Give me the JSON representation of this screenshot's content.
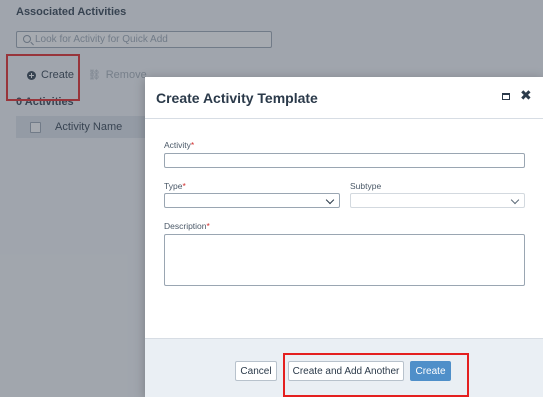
{
  "background": {
    "section_title": "Associated Activities",
    "quick_add_placeholder": "Look for Activity for Quick Add",
    "toolbar": {
      "create_label": "Create",
      "remove_label": "Remove"
    },
    "count_label": "0 Activities",
    "table": {
      "columns": [
        "Activity Name"
      ]
    }
  },
  "modal": {
    "title": "Create Activity Template",
    "fields": {
      "activity": {
        "label": "Activity",
        "required_mark": "*",
        "value": ""
      },
      "type": {
        "label": "Type",
        "required_mark": "*",
        "value": ""
      },
      "subtype": {
        "label": "Subtype",
        "value": ""
      },
      "description": {
        "label": "Description",
        "required_mark": "*",
        "value": ""
      }
    },
    "footer": {
      "cancel_label": "Cancel",
      "create_and_add_another_label": "Create and Add Another",
      "create_label": "Create"
    }
  },
  "colors": {
    "highlight": "#e41f1f",
    "primary_button": "#4f8fc9",
    "required": "#d12f2f"
  }
}
